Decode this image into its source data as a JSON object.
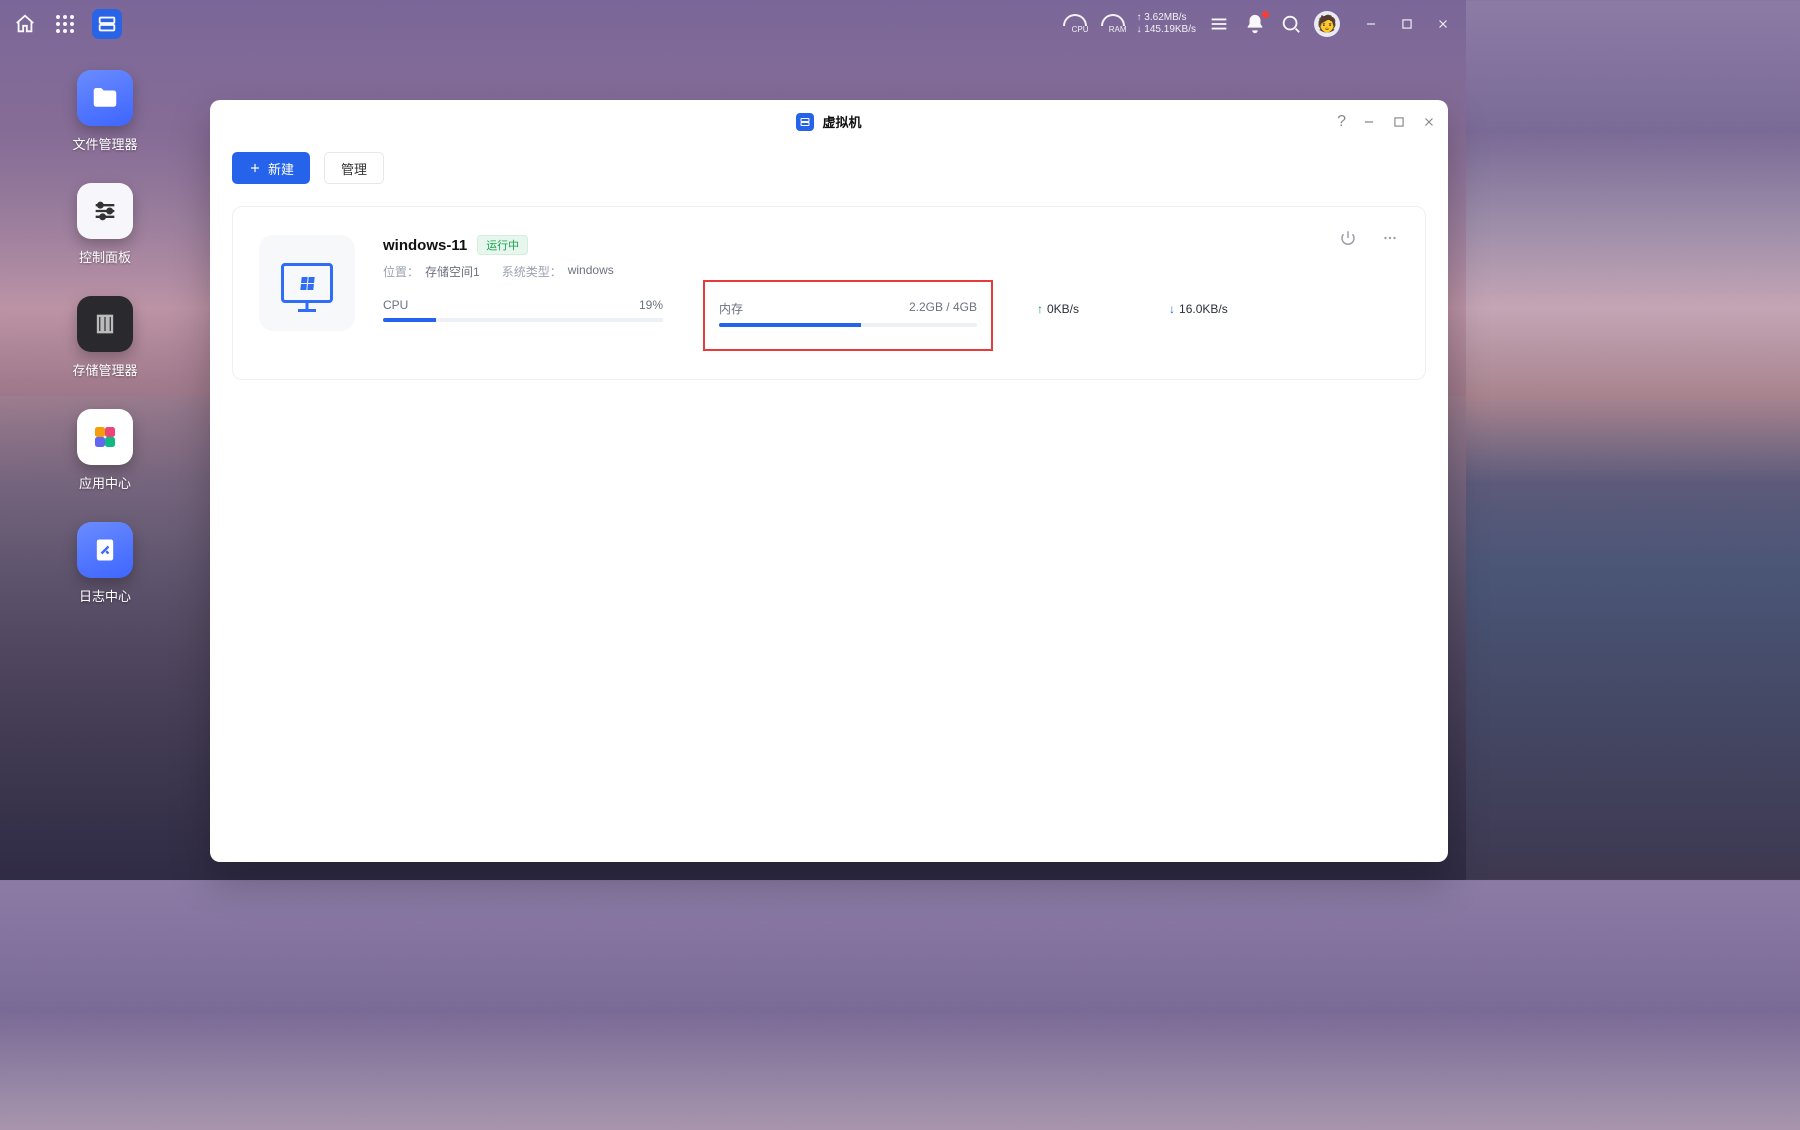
{
  "topbar": {
    "net_up": "↑ 3.62MB/s",
    "net_down": "↓ 145.19KB/s",
    "cpu_label": "CPU",
    "ram_label": "RAM"
  },
  "sidebar": {
    "items": [
      {
        "label": "文件管理器"
      },
      {
        "label": "控制面板"
      },
      {
        "label": "存储管理器"
      },
      {
        "label": "应用中心"
      },
      {
        "label": "日志中心"
      }
    ]
  },
  "window": {
    "title": "虚拟机",
    "help": "?",
    "new_button": "新建",
    "manage_button": "管理"
  },
  "vm": {
    "name": "windows-11",
    "status": "运行中",
    "location_key": "位置：",
    "location_val": "存储空间1",
    "ostype_key": "系统类型：",
    "ostype_val": "windows",
    "cpu_label": "CPU",
    "cpu_value": "19%",
    "cpu_pct": 19,
    "mem_label": "内存",
    "mem_value": "2.2GB / 4GB",
    "mem_pct": 55,
    "net_up": "0KB/s",
    "net_down": "16.0KB/s"
  }
}
